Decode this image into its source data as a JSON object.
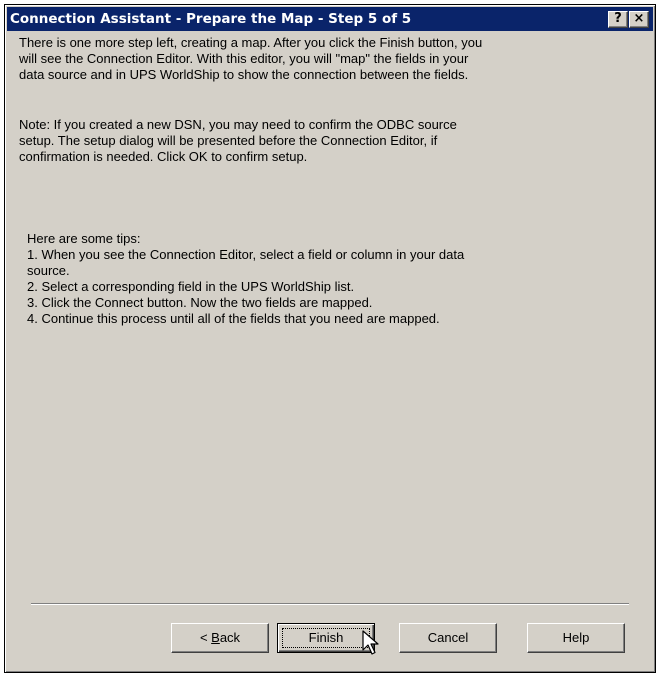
{
  "window": {
    "title": "Connection Assistant - Prepare the Map - Step 5 of 5",
    "help_button": "?",
    "close_button": "×"
  },
  "intro_lines": [
    "There is one more step left, creating a map. After you click the Finish button, you",
    "will see the Connection Editor. With this editor, you will  \"map\" the fields in your",
    "data source and in UPS WorldShip to show the connection between the fields."
  ],
  "note_lines": [
    "Note: If you created a new DSN, you may need to confirm the ODBC source",
    "setup. The setup dialog will be presented before the Connection Editor, if",
    "confirmation is needed.  Click OK to confirm setup."
  ],
  "tips": {
    "heading": "Here are some tips:",
    "items": [
      "1. When you see the Connection Editor, select a field or column in your data",
      "source.",
      "2. Select a corresponding field in the  UPS WorldShip list.",
      "3. Click the Connect button. Now the two fields are mapped.",
      "4. Continue this process until all of the fields that you need are mapped."
    ]
  },
  "buttons": {
    "back_prefix": "< ",
    "back_mnemonic": "B",
    "back_rest": "ack",
    "finish": "Finish",
    "cancel": "Cancel",
    "help": "Help"
  },
  "colors": {
    "title_bar": "#0a246a",
    "dialog_face": "#d4d0c8"
  }
}
